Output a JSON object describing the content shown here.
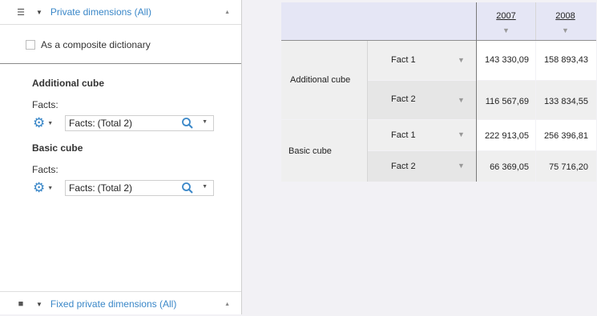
{
  "left_panel": {
    "top_header": {
      "title": "Private dimensions (All)",
      "menu_icon": "hamburger-icon",
      "caret_icon": "caret-down-icon",
      "collapse_icon": "collapse-up-icon"
    },
    "composite_checkbox": {
      "label": "As a composite dictionary",
      "checked": false
    },
    "cubes": [
      {
        "title": "Additional cube",
        "facts_label": "Facts:",
        "combo_prefix": "Facts:",
        "combo_value": "(Total 2)"
      },
      {
        "title": "Basic cube",
        "facts_label": "Facts:",
        "combo_prefix": "Facts:",
        "combo_value": "(Total 2)"
      }
    ],
    "bottom_header": {
      "title": "Fixed private dimensions (All)",
      "square_icon": "square-icon"
    }
  },
  "table": {
    "columns": [
      "2007",
      "2008"
    ],
    "rows": [
      {
        "cube": "Additional cube",
        "fact": "Fact 1",
        "values": [
          "143 330,09",
          "158 893,43"
        ]
      },
      {
        "cube": "",
        "fact": "Fact 2",
        "values": [
          "116 567,69",
          "133 834,55"
        ]
      },
      {
        "cube": "Basic cube",
        "fact": "Fact 1",
        "values": [
          "222 913,05",
          "256 396,81"
        ]
      },
      {
        "cube": "",
        "fact": "Fact 2",
        "values": [
          "66 369,05",
          "75 716,20"
        ]
      }
    ]
  },
  "colors": {
    "accent": "#3a87c8",
    "header_bg": "#e5e6f5"
  }
}
